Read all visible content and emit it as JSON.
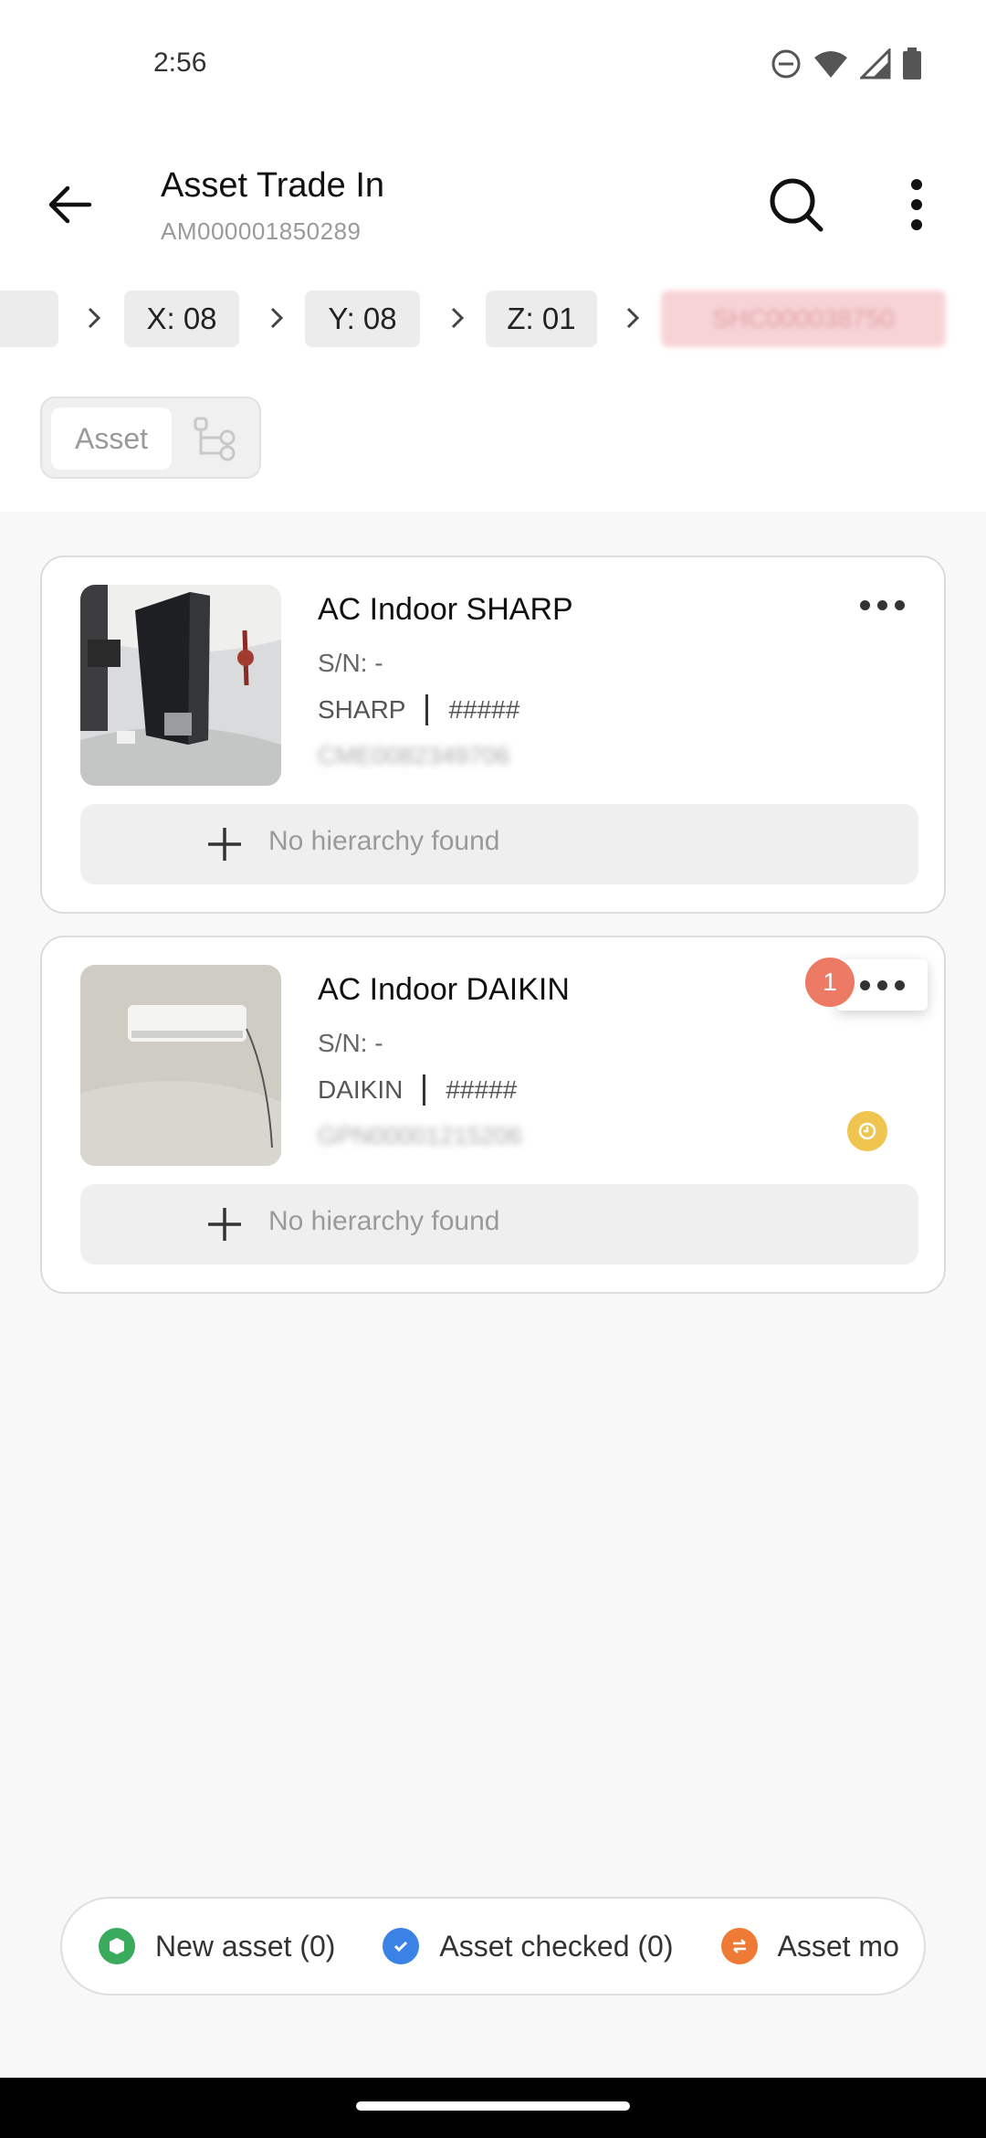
{
  "status_bar": {
    "time": "2:56",
    "icons": [
      "dnd-icon",
      "wifi-icon",
      "signal-icon",
      "battery-icon"
    ]
  },
  "header": {
    "title": "Asset Trade In",
    "subtitle": "AM000001850289"
  },
  "breadcrumb": {
    "items": [
      {
        "label": ""
      },
      {
        "label": "X: 08"
      },
      {
        "label": "Y: 08"
      },
      {
        "label": "Z: 01"
      },
      {
        "label": "SHC000038750"
      }
    ]
  },
  "view_toggle": {
    "asset_label": "Asset",
    "tree_icon": "hierarchy-tree-icon"
  },
  "assets": [
    {
      "name": "AC Indoor SHARP",
      "sn": "S/N: -",
      "brand": "SHARP",
      "model": "#####",
      "code": "CME0082349706",
      "hierarchy": "No hierarchy found",
      "badge": "",
      "status_color": ""
    },
    {
      "name": "AC Indoor DAIKIN",
      "sn": "S/N: -",
      "brand": "DAIKIN",
      "model": "#####",
      "code": "GPN00001215206",
      "hierarchy": "No hierarchy found",
      "badge": "1",
      "status_color": "#efc54f"
    }
  ],
  "legend": {
    "new_asset": "New asset (0)",
    "asset_checked": "Asset checked (0)",
    "asset_moved": "Asset mo",
    "colors": {
      "new": "#3aaa5c",
      "checked": "#3b82e6",
      "moved": "#ee7a35"
    }
  }
}
